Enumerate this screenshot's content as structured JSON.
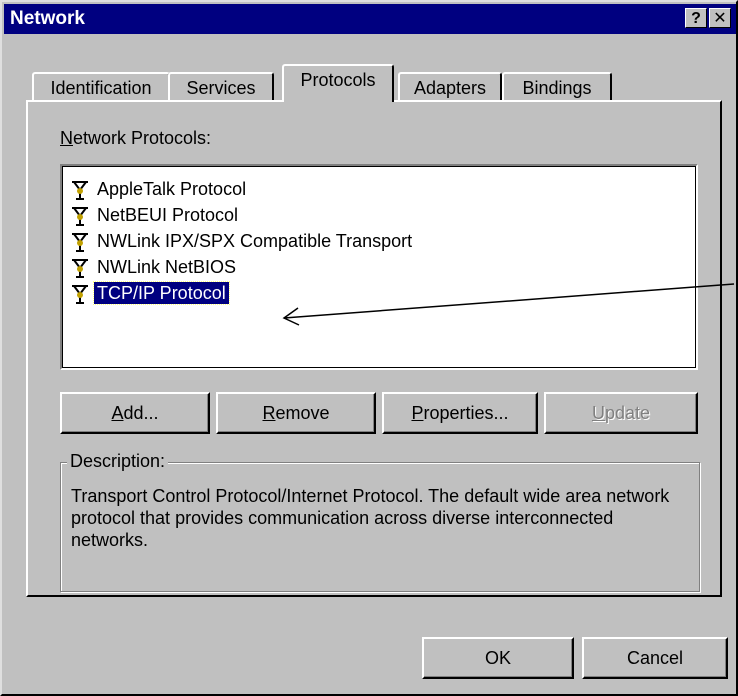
{
  "window": {
    "title": "Network",
    "help_button": "?",
    "close_button": "✕"
  },
  "tabs": [
    {
      "label": "Identification",
      "active": false
    },
    {
      "label": "Services",
      "active": false
    },
    {
      "label": "Protocols",
      "active": true
    },
    {
      "label": "Adapters",
      "active": false
    },
    {
      "label": "Bindings",
      "active": false
    }
  ],
  "protocols": {
    "label_mnemonic": "N",
    "label_rest": "etwork Protocols:",
    "items": [
      {
        "label": "AppleTalk Protocol",
        "selected": false
      },
      {
        "label": "NetBEUI Protocol",
        "selected": false
      },
      {
        "label": "NWLink IPX/SPX Compatible Transport",
        "selected": false
      },
      {
        "label": "NWLink NetBIOS",
        "selected": false
      },
      {
        "label": "TCP/IP Protocol",
        "selected": true
      }
    ],
    "icon": "network-protocol-icon"
  },
  "buttons": {
    "add": {
      "mnemonic": "A",
      "rest": "dd..."
    },
    "remove": {
      "mnemonic": "R",
      "rest": "emove"
    },
    "properties": {
      "mnemonic": "P",
      "rest": "roperties..."
    },
    "update": {
      "mnemonic": "U",
      "rest": "pdate",
      "disabled": true
    }
  },
  "description": {
    "legend": "Description:",
    "text": "Transport Control Protocol/Internet Protocol. The default wide area network protocol that provides communication across diverse interconnected networks."
  },
  "footer": {
    "ok": "OK",
    "cancel": "Cancel"
  },
  "colors": {
    "face": "#c0c0c0",
    "title": "#000080",
    "selection": "#000080"
  }
}
